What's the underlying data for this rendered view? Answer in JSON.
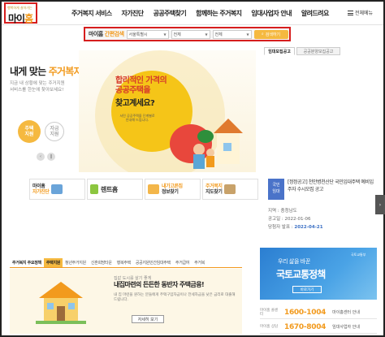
{
  "logo": {
    "tagline": "행복하게 살아가는",
    "text_a": "마이",
    "text_b": "홈"
  },
  "nav": {
    "items": [
      "주거복지 서비스",
      "자가진단",
      "공공주택찾기",
      "함께하는 주거복지",
      "임대사업자 안내",
      "알려드려요"
    ],
    "menu_all": "전체메뉴"
  },
  "search": {
    "title_a": "마이홈",
    "title_b": "간편검색",
    "region": "서울특별시",
    "type": "전체",
    "supply": "전체",
    "button": "검색하기"
  },
  "notice_tabs": [
    "임대모집공고",
    "공공분양모집공고"
  ],
  "intro": {
    "title_a": "내게 맞는",
    "title_b": "주거복지",
    "desc": "지금 내 상황에 맞는 주거지원서비스를 한눈에 찾아보세요!",
    "circle_on": "주택\n지원",
    "circle_off": "자금\n지원",
    "prev": "‹",
    "pause": "‖"
  },
  "hero": {
    "line1": "합리적인 가격의",
    "line2": "공공주택을",
    "line3": "찾고계세요?",
    "small": "서민 공공주택을 단계별로 안내해 드립니다."
  },
  "quick_links": [
    {
      "a": "마이홈",
      "b": "자가진단",
      "color": "#6aa4d9"
    },
    {
      "a": "",
      "b": "렌트홈",
      "color": "#8cc63f"
    },
    {
      "a": "내가고른집",
      "b": "정보찾기",
      "color": "#f3b64a"
    },
    {
      "a": "주거복지",
      "b": "지도찾기",
      "color": "#c8a26a"
    }
  ],
  "notice": {
    "badge": "국민\n임대",
    "title": "[정정공고] 천안병천산단 국민임대주택 예비입주자 수시모집 공고",
    "region_label": "지역 : 충청남도",
    "date_label": "공고일 : 2022-01-06",
    "winner_label": "당첨자 발표 :",
    "winner_date": "2022-04-21"
  },
  "side_tab": "›",
  "bottom_tabs": [
    "주거복지 주요정책",
    "주택지원",
    "청년주거지원",
    "신혼희망타운",
    "행복주택",
    "공공지원민간임대주택",
    "주거급여",
    "주거복"
  ],
  "bottom": {
    "sub": "집값 도시를 살기 좋게",
    "title": "내집마련의 든든한 동반자 주택금융!",
    "desc": "내 집 마련을 원하는 분들에게 주택구입자금이나 전세자금을 낮은 금리로 대출해 드립니다.",
    "button": "자세히 보기"
  },
  "banner": {
    "sub": "우리 삶을 바꾼",
    "title": "국토교통정책",
    "button": "바로가기",
    "ministry": "국토교통부"
  },
  "phones": [
    {
      "label": "마이홈 콜센터",
      "num": "1600-1004",
      "name": "마이홈센터 안내"
    },
    {
      "label": "마이홈 상담",
      "num": "1670-8004",
      "name": "임대사업자 안내"
    }
  ]
}
